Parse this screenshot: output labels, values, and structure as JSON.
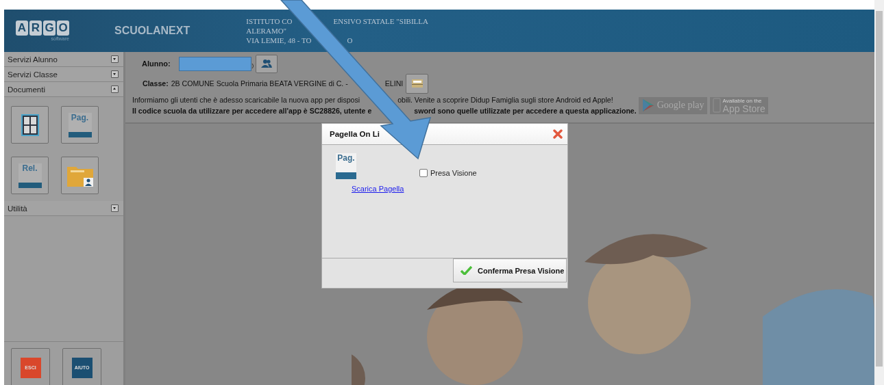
{
  "header": {
    "logo_letters": [
      "A",
      "R",
      "G",
      "O"
    ],
    "logo_caption": "software",
    "product": "SCUOLANEXT",
    "school_lines": [
      [
        "ISTITUTO CO",
        "ENSIVO STATALE \"SIBILLA"
      ],
      [
        "ALERAMO\""
      ],
      [
        "VIA LEMIE, 48 - TO",
        "O"
      ]
    ]
  },
  "sidebar": {
    "sections": [
      {
        "label": "Servizi Alunno",
        "expanded": false
      },
      {
        "label": "Servizi Classe",
        "expanded": false
      },
      {
        "label": "Documenti",
        "expanded": true,
        "tiles": [
          {
            "kind": "grid"
          },
          {
            "kind": "label",
            "label": "Pag."
          },
          {
            "kind": "label",
            "label": "Rel."
          },
          {
            "kind": "folder"
          }
        ]
      },
      {
        "label": "Utilità",
        "expanded": false
      }
    ],
    "footer_buttons": [
      {
        "label": "ESCI",
        "color": "#d9472b"
      },
      {
        "label": "AIUTO",
        "color": "#1b4f72"
      }
    ]
  },
  "student": {
    "label": "Alunno:",
    "trailing": ")"
  },
  "class_line": {
    "label": "Classe:",
    "parts": [
      "2B COMUNE Scuola Primaria BEATA VERGINE di C. -",
      "ELINI"
    ]
  },
  "notice": [
    {
      "bold": false,
      "parts": [
        "Informiamo gli utenti che è adesso scaricabile la nuova app per disposi",
        "obili. Venite a scoprire Didup Famiglia sugli store Android ed Apple!"
      ]
    },
    {
      "bold": true,
      "parts": [
        "Il codice scuola da utilizzare per accedere all'app è SC28826, utente e",
        "sword sono quelle utilizzate per accedere a questa applicazione."
      ]
    }
  ],
  "store_badges": [
    {
      "kind": "google",
      "big": "Google play"
    },
    {
      "kind": "apple",
      "small": "Available on the",
      "big": "App Store"
    }
  ],
  "dialog": {
    "title": "Pagella On Li",
    "icon_label": "Pag.",
    "link": "Scarica Pagella",
    "checkbox": {
      "label": "Presa Visione",
      "checked": false
    },
    "button": "Conferma Presa Visione"
  }
}
